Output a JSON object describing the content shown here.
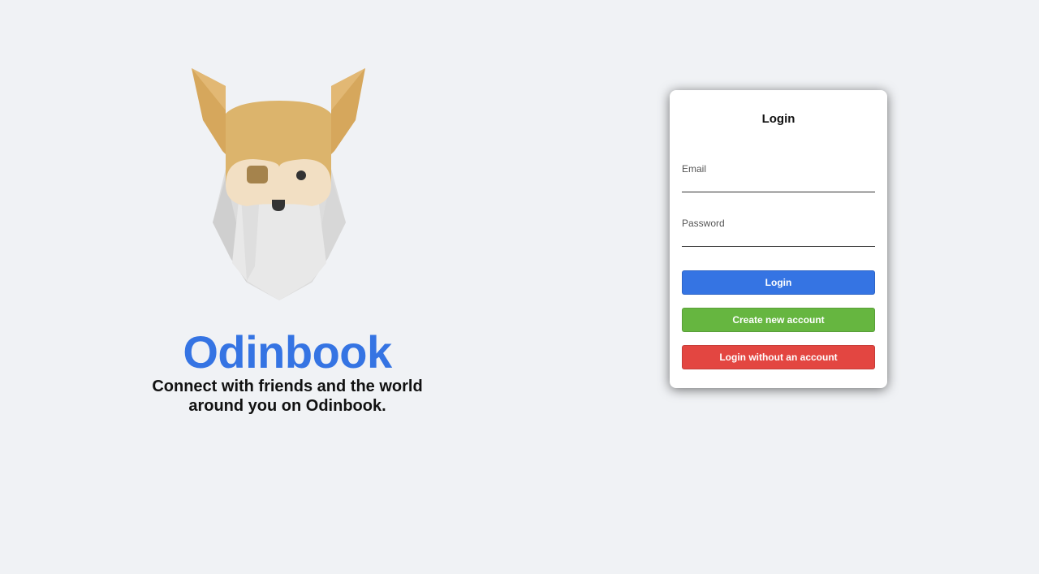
{
  "brand": {
    "logo": "odin-viking-logo",
    "name": "Odinbook",
    "tagline": "Connect with friends and the world around you on Odinbook."
  },
  "login_form": {
    "title": "Login",
    "email_label": "Email",
    "email_value": "",
    "password_label": "Password",
    "password_value": "",
    "login_button": "Login",
    "create_account_button": "Create new account",
    "guest_login_button": "Login without an account"
  },
  "colors": {
    "background": "#f0f2f5",
    "primary_blue": "#3574e3",
    "create_green": "#66b640",
    "guest_red": "#e34641"
  }
}
